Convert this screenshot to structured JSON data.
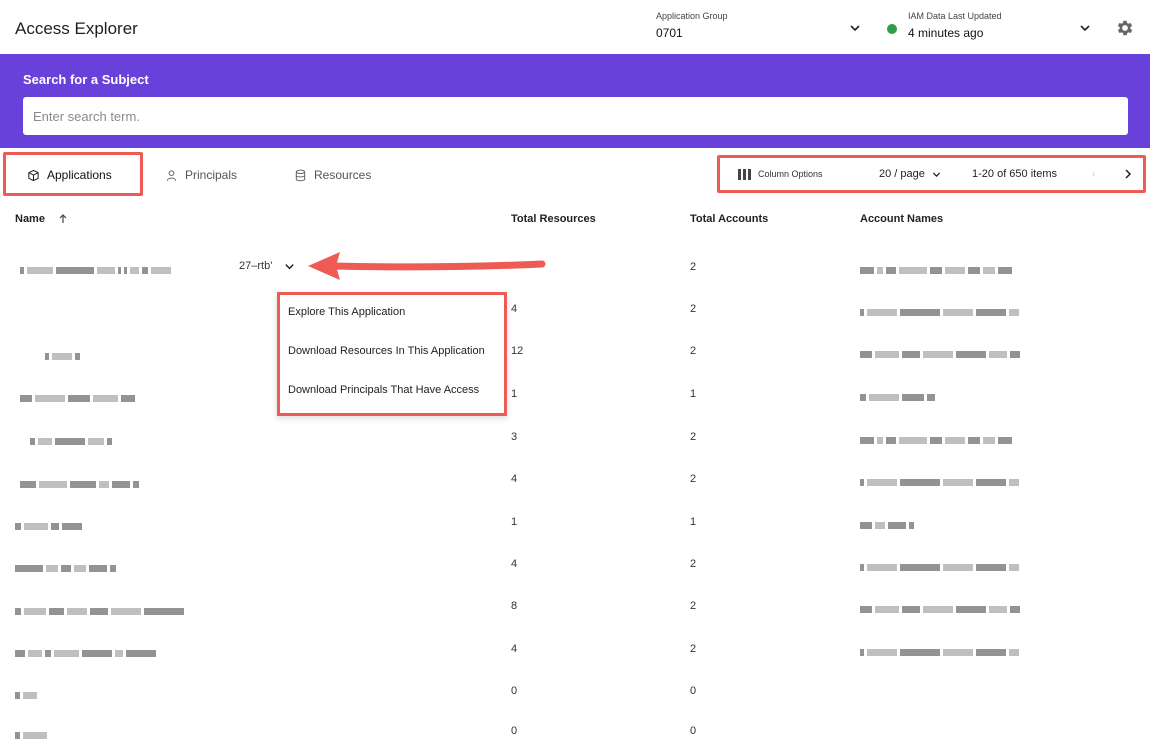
{
  "header": {
    "title": "Access Explorer",
    "app_group_label": "Application Group",
    "app_group_value": "0701",
    "iam_label": "IAM Data Last Updated",
    "iam_value": "4 minutes ago",
    "status_color": "#2f9e44",
    "icons": [
      "chevron-down-icon",
      "status-dot-icon",
      "gear-icon"
    ]
  },
  "search": {
    "title": "Search for a Subject",
    "placeholder": "Enter search term.",
    "band_color": "#6741d9"
  },
  "tabs": [
    {
      "label": "Applications",
      "icon": "cube-icon",
      "active": true
    },
    {
      "label": "Principals",
      "icon": "person-icon",
      "active": false
    },
    {
      "label": "Resources",
      "icon": "database-icon",
      "active": false
    }
  ],
  "toolbar": {
    "column_options": "Column Options",
    "per_page": "20 / page",
    "range": "1-20 of 650 items"
  },
  "table": {
    "columns": [
      "Name",
      "Total Resources",
      "Total Accounts",
      "Account Names"
    ],
    "first_row_suffix": "27–rtb'",
    "rows": [
      {
        "resources": "",
        "accounts": "2"
      },
      {
        "resources": "4",
        "accounts": "2"
      },
      {
        "resources": "12",
        "accounts": "2"
      },
      {
        "resources": "1",
        "accounts": "1"
      },
      {
        "resources": "3",
        "accounts": "2"
      },
      {
        "resources": "4",
        "accounts": "2"
      },
      {
        "resources": "1",
        "accounts": "1"
      },
      {
        "resources": "4",
        "accounts": "2"
      },
      {
        "resources": "8",
        "accounts": "2"
      },
      {
        "resources": "4",
        "accounts": "2"
      },
      {
        "resources": "0",
        "accounts": "0"
      },
      {
        "resources": "0",
        "accounts": "0"
      }
    ]
  },
  "menu": {
    "items": [
      "Explore This Application",
      "Download Resources In This Application",
      "Download Principals That Have Access"
    ]
  },
  "annotation_color": "#ee5b55"
}
